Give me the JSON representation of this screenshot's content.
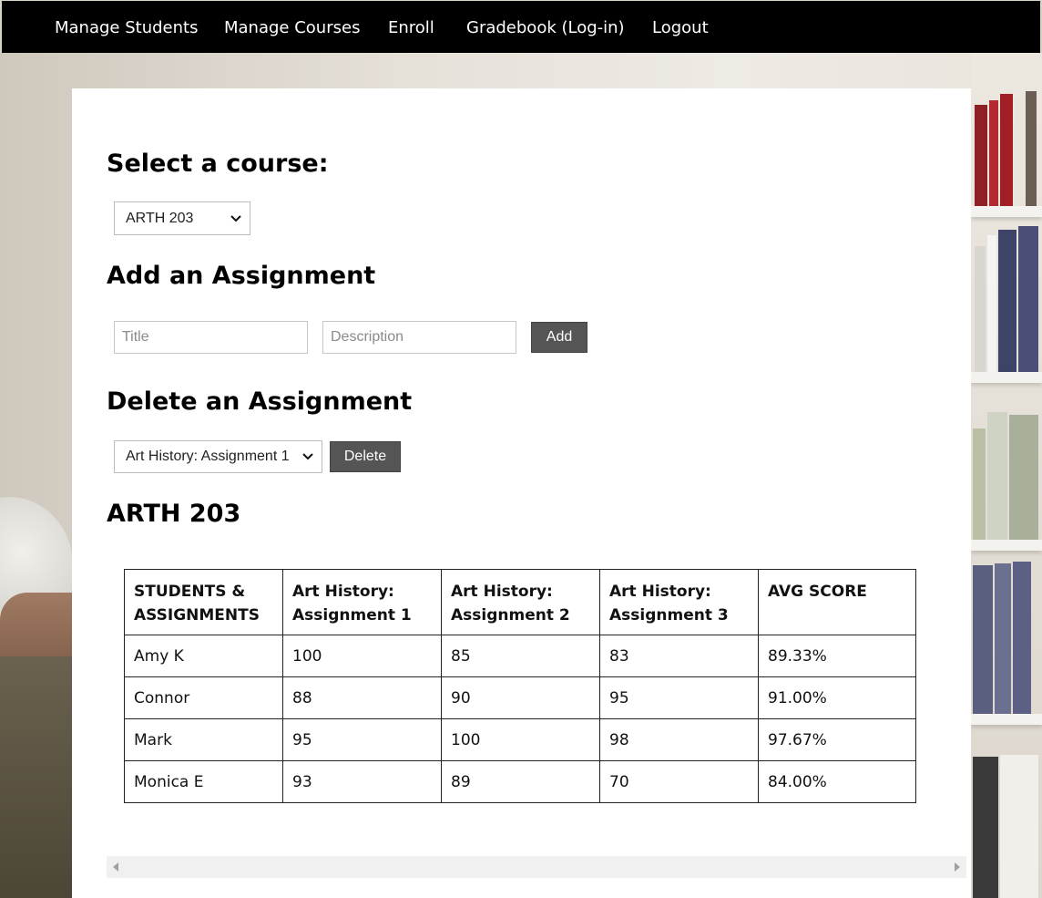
{
  "nav": {
    "items": [
      "Manage Students",
      "Manage Courses",
      "Enroll",
      "Gradebook (Log-in)",
      "Logout"
    ]
  },
  "select_course": {
    "heading": "Select a course:",
    "selected": "ARTH 203"
  },
  "add_assignment": {
    "heading": "Add an Assignment",
    "title_placeholder": "Title",
    "description_placeholder": "Description",
    "button_label": "Add"
  },
  "delete_assignment": {
    "heading": "Delete an Assignment",
    "selected": "Art History: Assignment 1",
    "button_label": "Delete"
  },
  "gradebook": {
    "course_heading": "ARTH 203",
    "columns": [
      "STUDENTS & ASSIGNMENTS",
      "Art History: Assignment 1",
      "Art History: Assignment 2",
      "Art History: Assignment 3",
      "AVG SCORE"
    ],
    "rows": [
      [
        "Amy K",
        "100",
        "85",
        "83",
        "89.33%"
      ],
      [
        "Connor",
        "88",
        "90",
        "95",
        "91.00%"
      ],
      [
        "Mark",
        "95",
        "100",
        "98",
        "97.67%"
      ],
      [
        "Monica E",
        "93",
        "89",
        "70",
        "84.00%"
      ]
    ]
  },
  "colors": {
    "navbar": "#000000",
    "button": "#555555",
    "panel": "#ffffff"
  }
}
